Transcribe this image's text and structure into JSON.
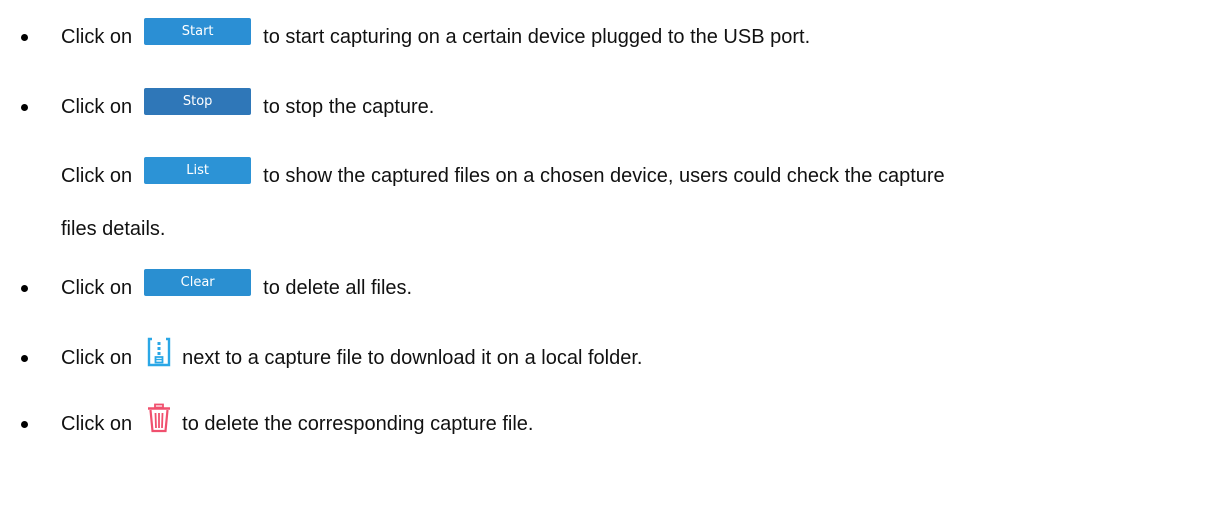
{
  "items": [
    {
      "prefix": "Click on",
      "button": "Start",
      "suffix": "to start capturing on a certain device plugged to the USB port."
    },
    {
      "prefix": "Click on",
      "button": "Stop",
      "suffix": "to stop the capture."
    },
    {
      "prefix": "Click on",
      "button": "List",
      "suffix": "to show the captured files on a chosen device, users could check the capture",
      "continuation": "files details."
    },
    {
      "prefix": "Click on",
      "button": "Clear",
      "suffix": "to delete all files."
    },
    {
      "prefix": "Click on",
      "icon": "download-file-icon",
      "suffix": "next to a capture file to download it on a local folder."
    },
    {
      "prefix": "Click on",
      "icon": "trash-icon",
      "suffix": "to delete the corresponding capture file."
    }
  ],
  "colors": {
    "button_blue": "#2b8fd4",
    "icon_blue": "#2aa7e6",
    "icon_red": "#f0506e",
    "text": "#111111"
  }
}
